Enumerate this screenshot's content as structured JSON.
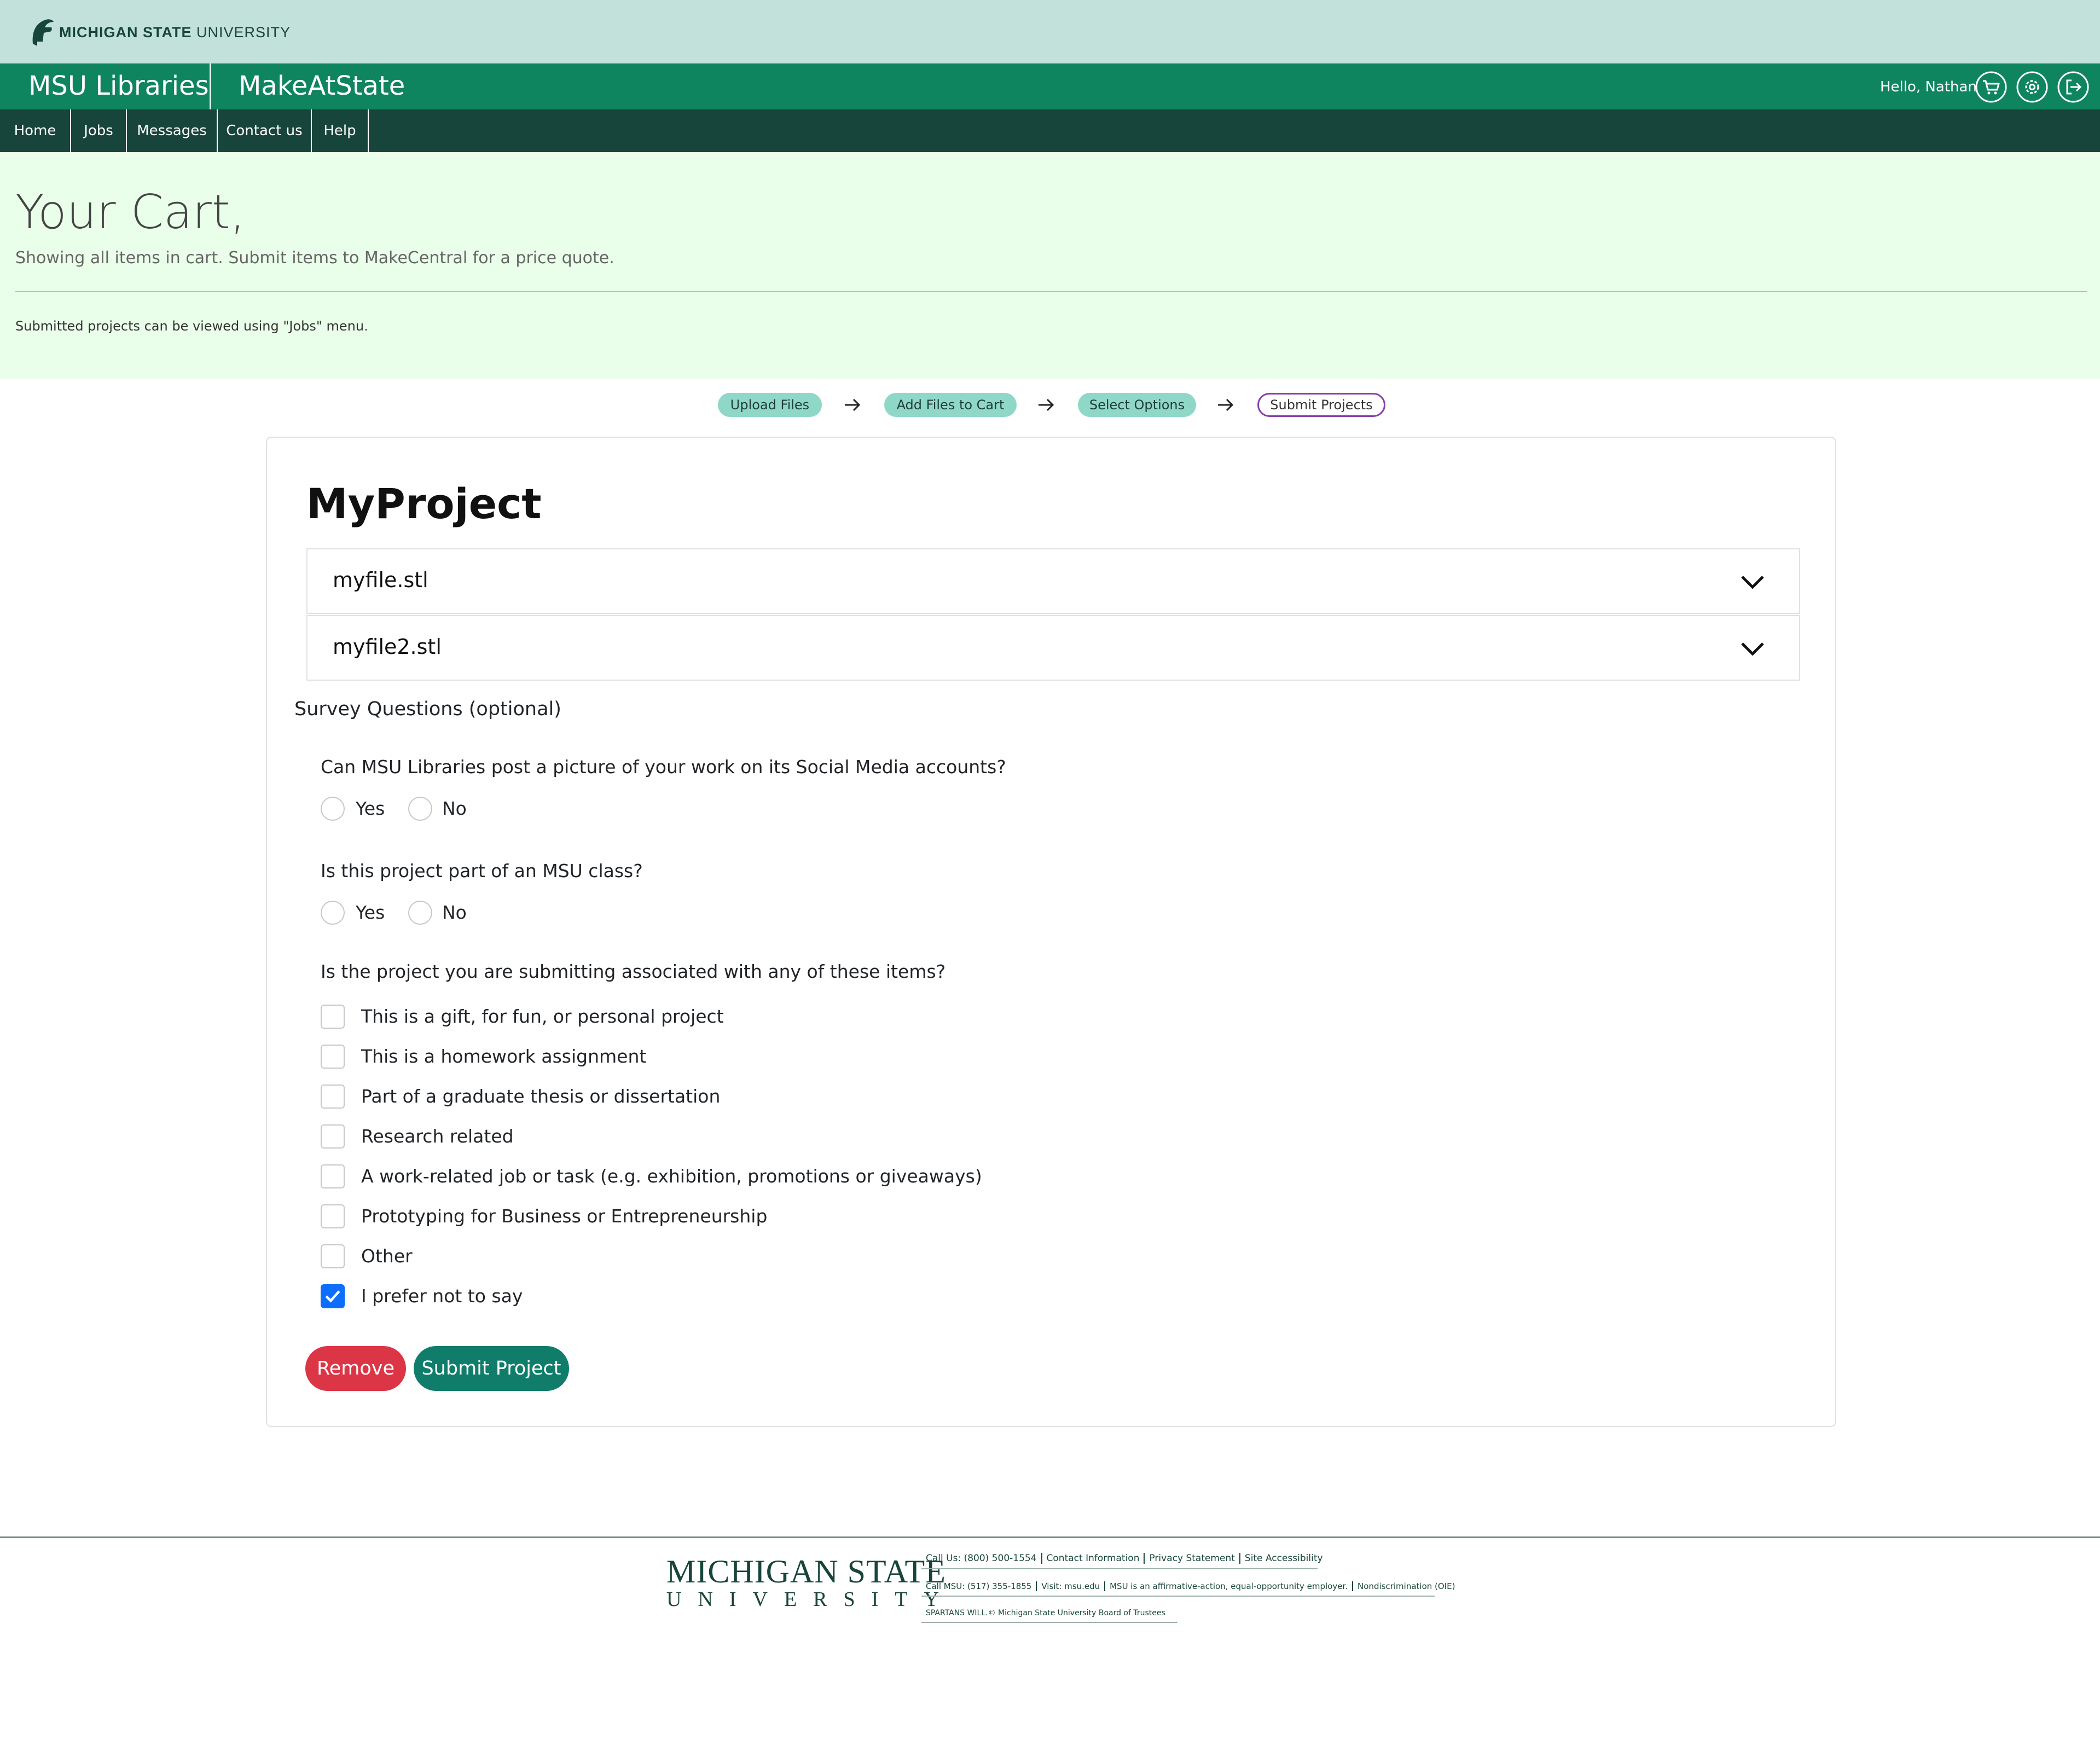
{
  "brand": {
    "name_bold": "MICHIGAN STATE",
    "name_light": "UNIVERSITY"
  },
  "app": {
    "title": "MSU Libraries",
    "subtitle": "MakeAtState",
    "greeting": "Hello, Nathan"
  },
  "nav": [
    "Home",
    "Jobs",
    "Messages",
    "Contact us",
    "Help"
  ],
  "header": {
    "title": "Your Cart,",
    "subtitle": "Showing all items in cart. Submit items to MakeCentral for a price quote.",
    "note": "Submitted projects can be viewed using \"Jobs\" menu."
  },
  "steps": [
    "Upload Files",
    "Add Files to Cart",
    "Select Options",
    "Submit Projects"
  ],
  "project": {
    "title": "MyProject",
    "files": [
      "myfile.stl",
      "myfile2.stl"
    ],
    "survey_title": "Survey Questions (optional)",
    "q1": {
      "text": "Can MSU Libraries post a picture of your work on its Social Media accounts?",
      "yes": "Yes",
      "no": "No"
    },
    "q2": {
      "text": "Is this project part of an MSU class?",
      "yes": "Yes",
      "no": "No"
    },
    "q3": {
      "text": "Is the project you are submitting associated with any of these items?",
      "options": [
        "This is a gift, for fun, or personal project",
        "This is a homework assignment",
        "Part of a graduate thesis or dissertation",
        "Research related",
        "A work-related job or task (e.g. exhibition, promotions or giveaways)",
        "Prototyping for Business or Entrepreneurship",
        "Other",
        "I prefer not to say"
      ],
      "checked": [
        false,
        false,
        false,
        false,
        false,
        false,
        false,
        true
      ]
    },
    "buttons": {
      "remove": "Remove",
      "submit": "Submit Project"
    }
  },
  "footer": {
    "msu_line1": "MICHIGAN STATE",
    "msu_line2": "UNIVERSITY",
    "row1": [
      "Call Us: (800) 500-1554",
      "Contact Information",
      "Privacy Statement",
      "Site Accessibility"
    ],
    "row2": [
      "Call MSU: (517) 355-1855",
      "Visit: msu.edu",
      "MSU is an affirmative-action, equal-opportunity employer.",
      "Nondiscrimination (OIE)"
    ],
    "row3": "SPARTANS WILL.© Michigan State University Board of Trustees"
  },
  "colors": {
    "brand_bar": "#c3e1db",
    "app_bar": "#0f855f",
    "nav": "#18453b",
    "header_band": "#eaffea",
    "remove": "#dc3545",
    "submit": "#0f7d6a",
    "checkbox_checked": "#0d6efd"
  },
  "icons": [
    "spartan-helmet-icon",
    "cart-icon",
    "settings-gear-icon",
    "logout-icon",
    "arrow-right-icon",
    "chevron-down-icon",
    "checkmark-icon"
  ]
}
